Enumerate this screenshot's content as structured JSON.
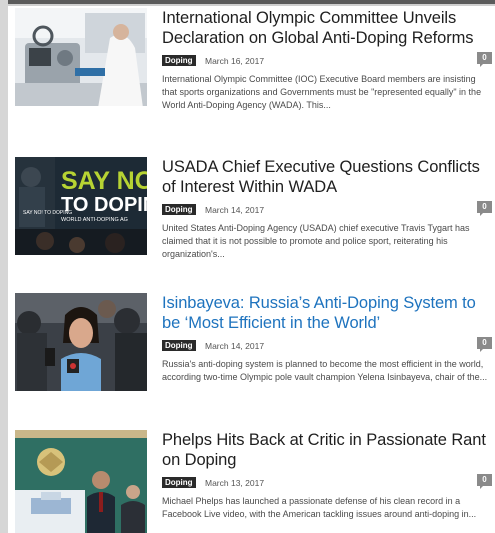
{
  "articles": [
    {
      "title": "International Olympic Committee Unveils Declaration on Global Anti-Doping Reforms",
      "category": "Doping",
      "date": "March 16, 2017",
      "comments": "0",
      "excerpt": "International Olympic Committee (IOC) Executive Board members are insisting that sports organizations and Governments must be \"represented equally\" in the World Anti-Doping Agency (WADA). This..."
    },
    {
      "title": "USADA Chief Executive Questions Conflicts of Interest Within WADA",
      "category": "Doping",
      "date": "March 14, 2017",
      "comments": "0",
      "excerpt": "United States Anti-Doping Agency (USADA) chief executive Travis Tygart has claimed that it is not possible to promote and police sport, reiterating his organization's...",
      "image_text": {
        "line1": "SAY NO",
        "line2": "TO DOPIN",
        "line3": "WORLD ANTI-DOPING AG",
        "corner": "SAY NO! TO DOPING"
      }
    },
    {
      "title": "Isinbayeva: Russia’s Anti-Doping System to be ‘Most Efficient in the World’",
      "category": "Doping",
      "date": "March 14, 2017",
      "comments": "0",
      "excerpt": "Russia's anti-doping system is planned to become the most efficient in the world, according two-time Olympic pole vault champion Yelena Isinbayeva, chair of the..."
    },
    {
      "title": "Phelps Hits Back at Critic in Passionate Rant on Doping",
      "category": "Doping",
      "date": "March 13, 2017",
      "comments": "0",
      "excerpt": "Michael Phelps has launched a passionate defense of his clean record in a Facebook Live video, with the American tackling issues around anti-doping in..."
    }
  ],
  "colors": {
    "title": "#1f1f1f",
    "title_hover": "#1e73be",
    "tag_bg": "#2a2a2a",
    "count_bg": "#8a8a8a",
    "excerpt": "#4a4a4a"
  }
}
